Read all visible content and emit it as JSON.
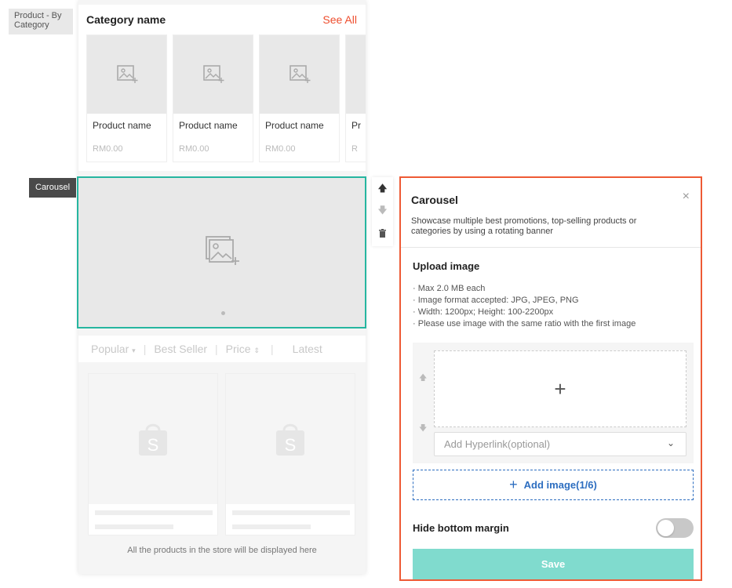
{
  "labels": {
    "category_section": "Product - By Category",
    "carousel_section": "Carousel"
  },
  "category": {
    "title": "Category name",
    "see_all": "See All",
    "products": [
      {
        "name": "Product name",
        "price": "RM0.00"
      },
      {
        "name": "Product name",
        "price": "RM0.00"
      },
      {
        "name": "Product name",
        "price": "RM0.00"
      },
      {
        "name": "Pr",
        "price": "R"
      }
    ]
  },
  "sort_bar": {
    "popular": "Popular",
    "best_seller": "Best Seller",
    "price": "Price",
    "latest": "Latest"
  },
  "all_products_note": "All the products in the store will be displayed here",
  "panel": {
    "title": "Carousel",
    "close": "×",
    "description": "Showcase multiple best promotions, top-selling products or categories by using a rotating banner",
    "upload_title": "Upload image",
    "upload_rules": [
      "Max 2.0 MB each",
      "Image format accepted: JPG, JPEG, PNG",
      "Width: 1200px; Height: 100-2200px",
      "Please use image with the same ratio with the first image"
    ],
    "upload_plus": "+",
    "hyperlink_placeholder": "Add Hyperlink(optional)",
    "add_image_label": "Add image(1/6)",
    "hide_bottom_margin": "Hide bottom margin",
    "hide_bottom_margin_on": false,
    "save_label": "Save"
  },
  "colors": {
    "accent": "#ee4d2d",
    "teal": "#26b6a0",
    "link_blue": "#2d6ec0",
    "save_bg": "#80dbce"
  },
  "icons": [
    "image-placeholder-icon",
    "arrow-up-icon",
    "arrow-down-icon",
    "trash-icon",
    "shopping-bag-icon",
    "chevron-down-icon",
    "close-icon",
    "plus-icon"
  ]
}
